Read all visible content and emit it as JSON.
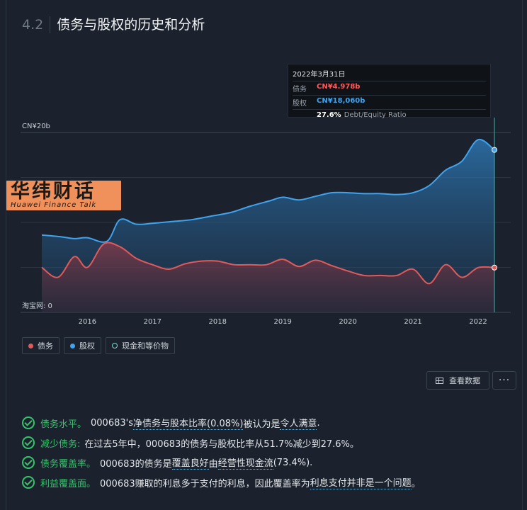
{
  "section": {
    "number": "4.2",
    "title": "债务与股权的历史和分析"
  },
  "tooltip": {
    "date": "2022年3月31日",
    "debt_label": "债务",
    "debt_value": "CN¥4.978b",
    "equity_label": "股权",
    "equity_value": "CN¥18,060b",
    "ratio_value": "27.6%",
    "ratio_label": "Debt/Equity Ratio"
  },
  "watermark": {
    "cn": "华纬财话",
    "en": "Huawei Finance Talk"
  },
  "chart_data": {
    "type": "area",
    "y_top_label": "CN¥20b",
    "y_bottom_label": "淘宝网: 0",
    "ylim": [
      0,
      20
    ],
    "xlim": [
      2015.3,
      2022.5
    ],
    "x_ticks": [
      "2016",
      "2017",
      "2018",
      "2019",
      "2020",
      "2021",
      "2022"
    ],
    "x_tick_values": [
      2016,
      2017,
      2018,
      2019,
      2020,
      2021,
      2022
    ],
    "series": [
      {
        "name": "股权",
        "color": "#3fa3ee",
        "x": [
          2015.3,
          2015.6,
          2015.8,
          2016.0,
          2016.3,
          2016.5,
          2016.75,
          2017.0,
          2017.3,
          2017.6,
          2017.9,
          2018.2,
          2018.5,
          2018.8,
          2019.0,
          2019.25,
          2019.5,
          2019.75,
          2020.0,
          2020.25,
          2020.5,
          2020.75,
          2021.0,
          2021.25,
          2021.5,
          2021.75,
          2022.0,
          2022.25
        ],
        "y": [
          8.6,
          8.4,
          8.2,
          8.3,
          7.9,
          10.3,
          9.8,
          9.9,
          10.1,
          10.3,
          10.7,
          11.1,
          11.8,
          12.4,
          12.8,
          12.5,
          12.9,
          13.3,
          13.3,
          13.2,
          13.2,
          13.1,
          13.3,
          14.1,
          15.8,
          16.8,
          19.2,
          18.06
        ]
      },
      {
        "name": "债务",
        "color": "#e05a5a",
        "x": [
          2015.3,
          2015.55,
          2015.8,
          2016.0,
          2016.25,
          2016.5,
          2016.75,
          2017.0,
          2017.25,
          2017.5,
          2017.75,
          2018.0,
          2018.25,
          2018.5,
          2018.75,
          2019.0,
          2019.25,
          2019.5,
          2019.75,
          2020.0,
          2020.25,
          2020.5,
          2020.75,
          2021.0,
          2021.25,
          2021.5,
          2021.75,
          2022.0,
          2022.25
        ],
        "y": [
          5.0,
          3.9,
          6.2,
          5.0,
          7.6,
          7.3,
          6.0,
          5.3,
          4.8,
          5.4,
          5.7,
          5.7,
          5.3,
          5.3,
          5.3,
          5.9,
          5.1,
          5.8,
          5.2,
          4.6,
          4.1,
          4.1,
          4.1,
          4.8,
          3.2,
          5.3,
          3.9,
          4.978,
          4.978
        ]
      }
    ],
    "legend": [
      "债务",
      "股权",
      "现金和等价物"
    ],
    "legend_placement": "bottom-left",
    "grid": true
  },
  "actions": {
    "view_data": "查看数据",
    "more": "···"
  },
  "checks": [
    {
      "lead": "债务水平。",
      "text1": "000683's ",
      "link1": "净债务与股本比率(0.08%)",
      "text2": "被认为是 ",
      "link2": "令人满意",
      "text3": "."
    },
    {
      "lead": "减少债务:",
      "text1": "在过去5年中，000683的债务与股权比率从51.7%减少到27.6%。"
    },
    {
      "lead": "债务覆盖率。",
      "text1": "000683的债务是 ",
      "link1": "覆盖良好",
      "text2": "由 ",
      "link2": "经营性现金流",
      "text3": "(73.4%)."
    },
    {
      "lead": "利益覆盖面。",
      "text1": "000683赚取的利息多于支付的利息，因此覆盖率为 ",
      "link1": "利息支付并非是一个问题",
      "text2": "。"
    }
  ]
}
